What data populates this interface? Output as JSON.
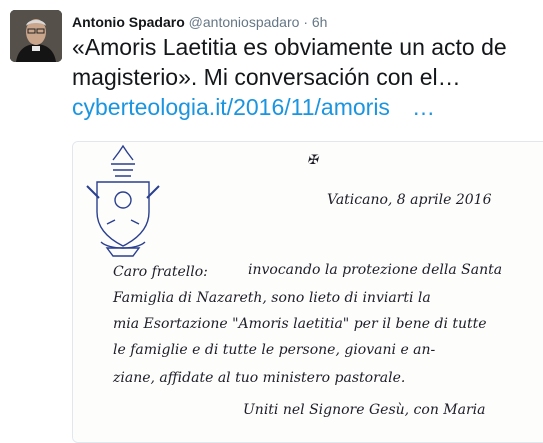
{
  "tweet": {
    "author_name": "Antonio Spadaro",
    "handle": "@antoniospadaro",
    "separator": "·",
    "time": "6h",
    "text_line1": "«Amoris Laetitia es obviamente un acto de",
    "text_line2": "magisterio». Mi conversación con el…",
    "link_text": "cyberteologia.it/2016/11/amoris",
    "link_ellipsis": "…"
  },
  "letter": {
    "cross_mark": "✠",
    "dateline": "Vaticano, 8 aprile 2016",
    "lines": [
      "Caro fratello:",
      "invocando la protezione della Santa",
      "Famiglia di Nazareth, sono lieto di inviarti la",
      "mia Esortazione \"Amoris laetitia\" per il bene di tutte",
      "le famiglie e di tutte le persone, giovani e an-",
      "ziane, affidate al tuo ministero pastorale.",
      "Uniti nel Signore Gesù, con Maria"
    ]
  }
}
